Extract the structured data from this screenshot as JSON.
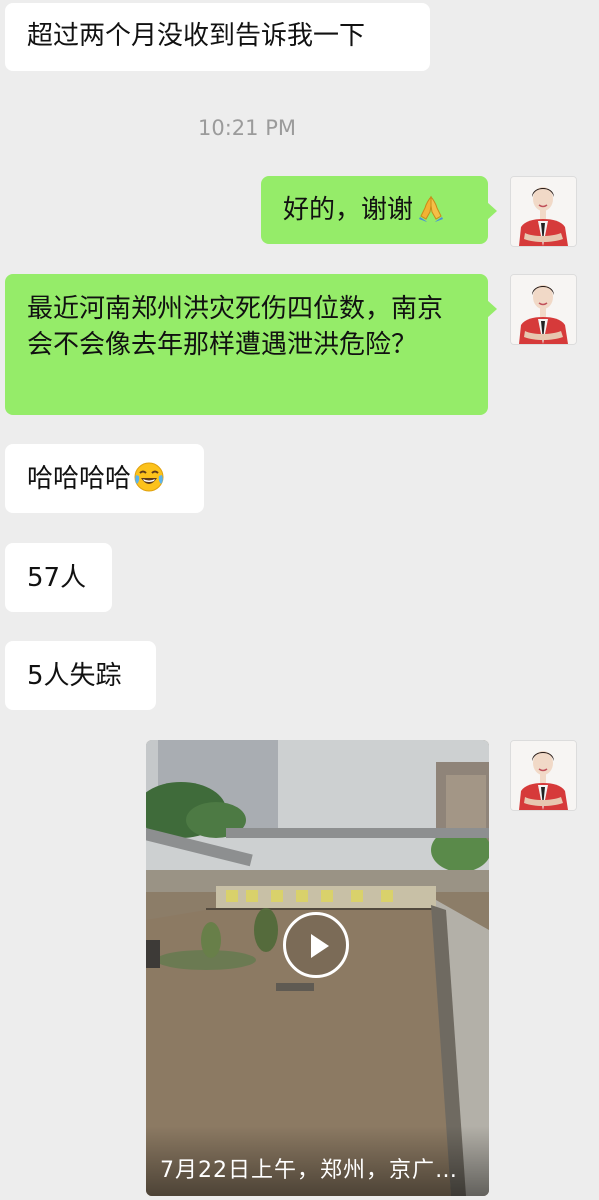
{
  "messages": [
    {
      "side": "in",
      "text": "超过两个月没收到告诉我一下"
    },
    {
      "side": "out",
      "text": "好的，谢谢",
      "emoji": "folded-hands-icon"
    },
    {
      "side": "out",
      "text": "最近河南郑州洪灾死伤四位数，南京会不会像去年那样遭遇泄洪危险？"
    },
    {
      "side": "in",
      "text": "哈哈哈哈",
      "emoji": "tears-of-joy-icon"
    },
    {
      "side": "in",
      "text": "57人"
    },
    {
      "side": "in",
      "text": "5人失踪"
    }
  ],
  "timestamp": "10:21 PM",
  "video": {
    "caption": "7月22日上午，郑州，京广…",
    "icon": "play-icon"
  },
  "colors": {
    "background": "#ededed",
    "incoming_bubble": "#ffffff",
    "outgoing_bubble": "#95ec69",
    "timestamp": "#9b9b9b"
  }
}
